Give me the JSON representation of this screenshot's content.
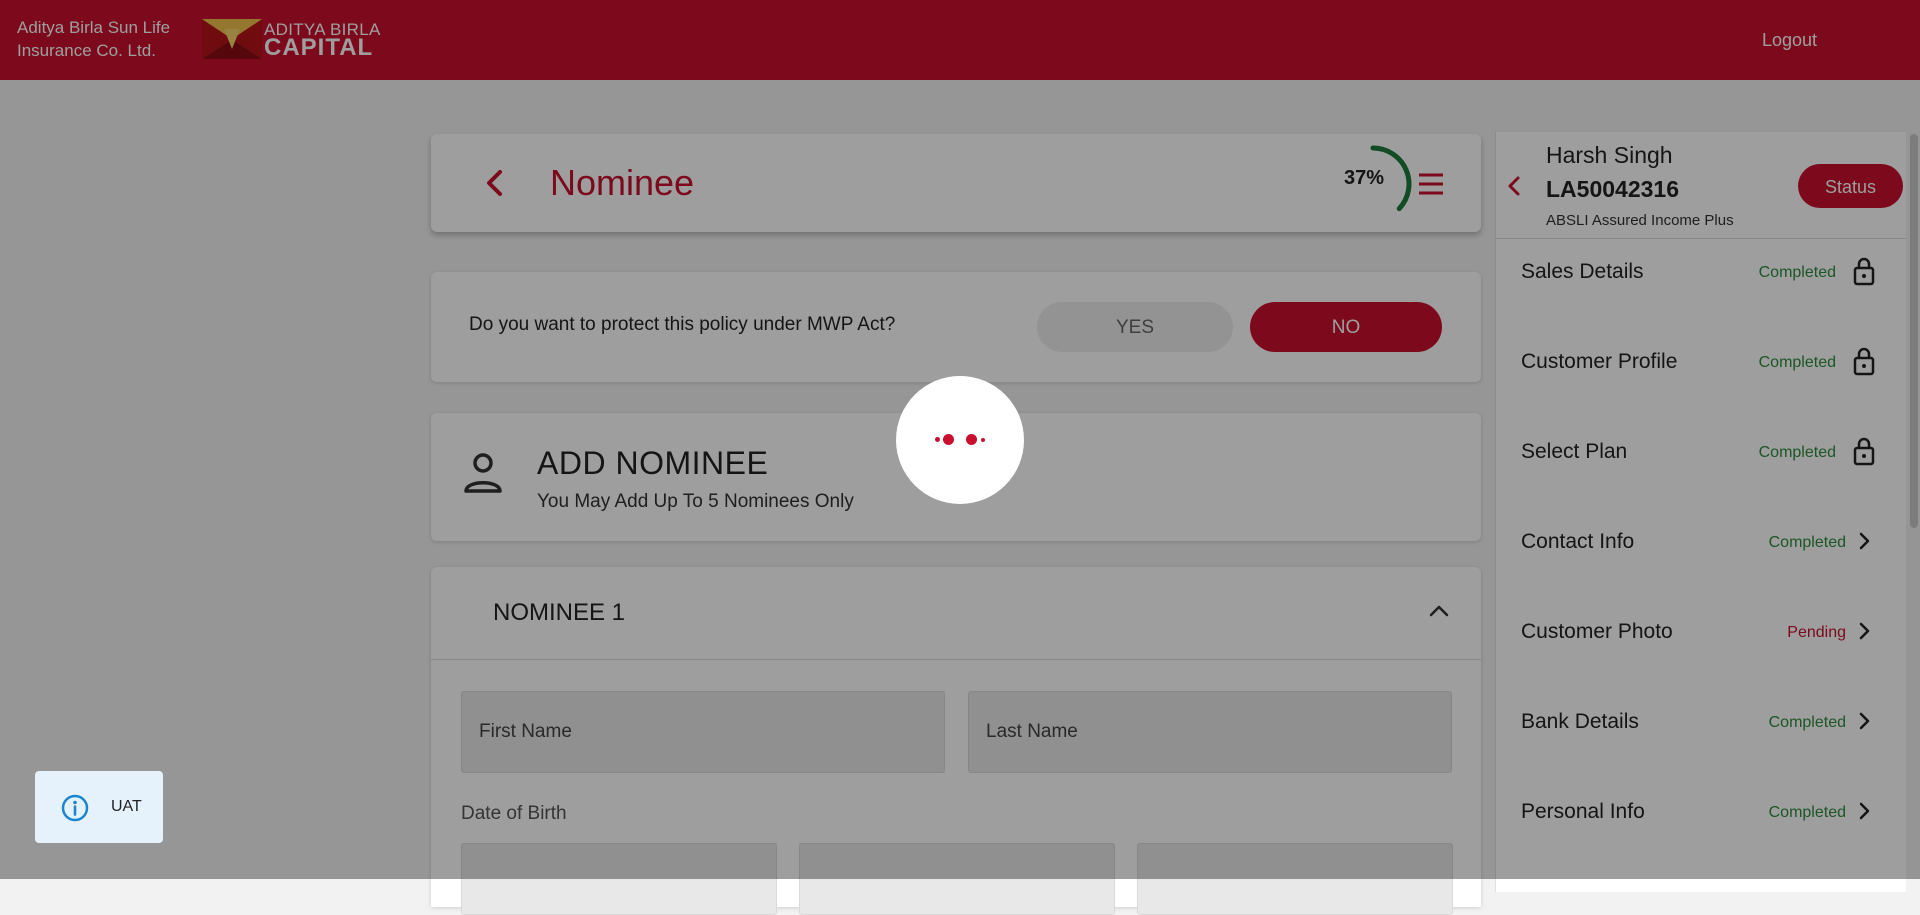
{
  "header": {
    "company_line1": "Aditya Birla Sun Life",
    "company_line2": "Insurance Co. Ltd.",
    "logo_line1": "ADITYA BIRLA",
    "logo_line2": "CAPITAL",
    "logout_label": "Logout",
    "brand_color": "#c8102e"
  },
  "page": {
    "title": "Nominee",
    "progress_label": "37%",
    "progress_value": 0.37,
    "back_icon": "chevron-left-icon",
    "menu_icon": "hamburger-menu-icon"
  },
  "mwp": {
    "question": "Do you want to protect this policy under MWP Act?",
    "yes_label": "YES",
    "no_label": "NO",
    "selected": "NO"
  },
  "add_nominee": {
    "title": "ADD NOMINEE",
    "subtitle": "You May Add Up To 5 Nominees Only",
    "icon": "person-icon"
  },
  "nominee1": {
    "title": "NOMINEE 1",
    "first_name_placeholder": "First Name",
    "last_name_placeholder": "Last Name",
    "dob_label": "Date of Birth"
  },
  "customer": {
    "name": "Harsh Singh",
    "id": "LA50042316",
    "plan": "ABSLI Assured Income Plus",
    "status_label": "Status"
  },
  "sections": [
    {
      "label": "Sales Details",
      "status": "Completed",
      "icon": "lock-icon"
    },
    {
      "label": "Customer Profile",
      "status": "Completed",
      "icon": "lock-icon"
    },
    {
      "label": "Select Plan",
      "status": "Completed",
      "icon": "lock-icon"
    },
    {
      "label": "Contact Info",
      "status": "Completed",
      "icon": "chevron-right-icon"
    },
    {
      "label": "Customer Photo",
      "status": "Pending",
      "icon": "chevron-right-icon"
    },
    {
      "label": "Bank Details",
      "status": "Completed",
      "icon": "chevron-right-icon"
    },
    {
      "label": "Personal Info",
      "status": "Completed",
      "icon": "chevron-right-icon"
    }
  ],
  "toast": {
    "label": "UAT",
    "icon": "info-icon"
  },
  "loader": {
    "icon": "loading-dots-icon"
  }
}
